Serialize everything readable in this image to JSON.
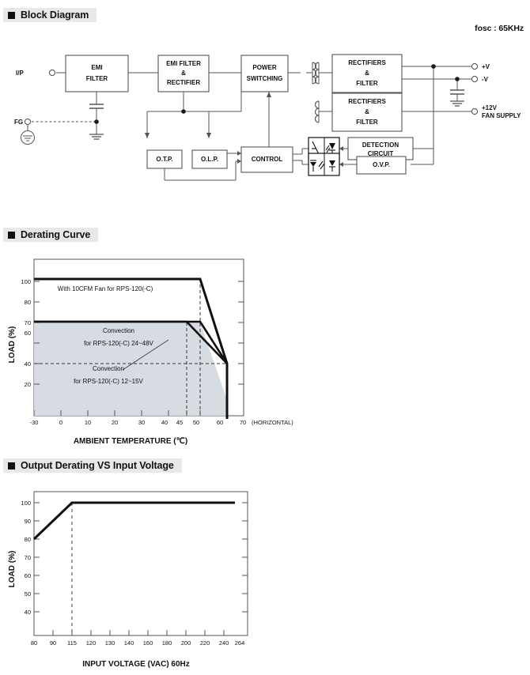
{
  "sections": [
    {
      "id": "block-diagram",
      "title": "Block Diagram"
    },
    {
      "id": "derating-curve",
      "title": "Derating Curve"
    },
    {
      "id": "output-derating",
      "title": "Output Derating VS Input Voltage"
    }
  ],
  "block_diagram": {
    "fosc_label": "fosc : 65KHz",
    "input_terminals": [
      {
        "name": "ip",
        "label": "I/P"
      },
      {
        "name": "fg",
        "label": "FG"
      }
    ],
    "output_terminals": [
      {
        "name": "pos-v",
        "label": "+V"
      },
      {
        "name": "neg-v",
        "label": "-V"
      },
      {
        "name": "fan-supply",
        "label_line1": "+12V",
        "label_line2": "FAN SUPPLY"
      }
    ],
    "blocks": [
      {
        "name": "emi-filter",
        "lines": [
          "EMI",
          "FILTER"
        ]
      },
      {
        "name": "emi-filter-rectifier",
        "lines": [
          "EMI FILTER",
          "&",
          "RECTIFIER"
        ]
      },
      {
        "name": "power-switching",
        "lines": [
          "POWER",
          "SWITCHING"
        ]
      },
      {
        "name": "rectifiers-filter-main",
        "lines": [
          "RECTIFIERS",
          "&",
          "FILTER"
        ]
      },
      {
        "name": "rectifiers-filter-fan",
        "lines": [
          "RECTIFIERS",
          "&",
          "FILTER"
        ]
      },
      {
        "name": "otp",
        "lines": [
          "O.T.P."
        ]
      },
      {
        "name": "olp",
        "lines": [
          "O.L.P."
        ]
      },
      {
        "name": "control",
        "lines": [
          "CONTROL"
        ]
      },
      {
        "name": "detection-circuit",
        "lines": [
          "DETECTION",
          "CIRCUIT"
        ]
      },
      {
        "name": "ovp",
        "lines": [
          "O.V.P."
        ]
      }
    ]
  },
  "chart_data": [
    {
      "name": "derating-curve",
      "type": "line",
      "title": "Derating Curve",
      "xlabel": "AMBIENT TEMPERATURE (℃)",
      "ylabel": "LOAD (%)",
      "xlim": [
        -30,
        75
      ],
      "ylim": [
        0,
        108
      ],
      "xticks": [
        -30,
        0,
        10,
        20,
        30,
        40,
        45,
        50,
        60,
        70
      ],
      "xticklabels": [
        "-30",
        "0",
        "10",
        "20",
        "30",
        "40",
        "45",
        "50",
        "60",
        "70"
      ],
      "yticks": [
        20,
        40,
        60,
        70,
        80,
        100
      ],
      "yticklabels": [
        "20",
        "40",
        "60",
        "70",
        "80",
        "100"
      ],
      "grid": false,
      "axis_note": "(HORIZONTAL)",
      "annotations": [
        {
          "name": "fan-note",
          "text": "With 10CFM Fan for RPS-120(-C)"
        },
        {
          "name": "convection-24-48-line1",
          "text": "Convection"
        },
        {
          "name": "convection-24-48-line2",
          "text": "for RPS-120(-C) 24~48V"
        },
        {
          "name": "convection-12-15-line1",
          "text": "Convection"
        },
        {
          "name": "convection-12-15-line2",
          "text": "for RPS-120(-C) 12~15V"
        }
      ],
      "guide_lines": [
        {
          "name": "vline-45",
          "x": 45
        },
        {
          "name": "vline-50",
          "x": 50
        },
        {
          "name": "hline-40",
          "y": 40
        }
      ],
      "series": [
        {
          "name": "With 10CFM Fan for RPS-120(-C)",
          "x": [
            -30,
            50,
            70,
            70
          ],
          "values": [
            100,
            100,
            40,
            0
          ]
        },
        {
          "name": "Convection for RPS-120(-C) 24~48V",
          "x": [
            -30,
            50,
            70
          ],
          "values": [
            70,
            70,
            40
          ]
        },
        {
          "name": "Convection for RPS-120(-C) 12~15V",
          "x": [
            -30,
            45,
            70
          ],
          "values": [
            70,
            70,
            40
          ]
        }
      ]
    },
    {
      "name": "output-derating-vs-input-voltage",
      "type": "line",
      "title": "Output Derating VS Input Voltage",
      "xlabel": "INPUT VOLTAGE (VAC) 60Hz",
      "ylabel": "LOAD (%)",
      "xlim": [
        80,
        264
      ],
      "ylim": [
        30,
        105
      ],
      "xticks": [
        80,
        90,
        115,
        120,
        130,
        140,
        160,
        180,
        200,
        220,
        240,
        264
      ],
      "xticklabels": [
        "80",
        "90",
        "115",
        "120",
        "130",
        "140",
        "160",
        "180",
        "200",
        "220",
        "240",
        "264"
      ],
      "yticks": [
        40,
        50,
        60,
        70,
        80,
        90,
        100
      ],
      "yticklabels": [
        "40",
        "50",
        "60",
        "70",
        "80",
        "90",
        "100"
      ],
      "grid": false,
      "guide_lines": [
        {
          "name": "vline-115",
          "x": 115
        }
      ],
      "series": [
        {
          "name": "Output load vs input voltage",
          "x": [
            80,
            115,
            264
          ],
          "values": [
            80,
            100,
            100
          ]
        }
      ]
    }
  ]
}
